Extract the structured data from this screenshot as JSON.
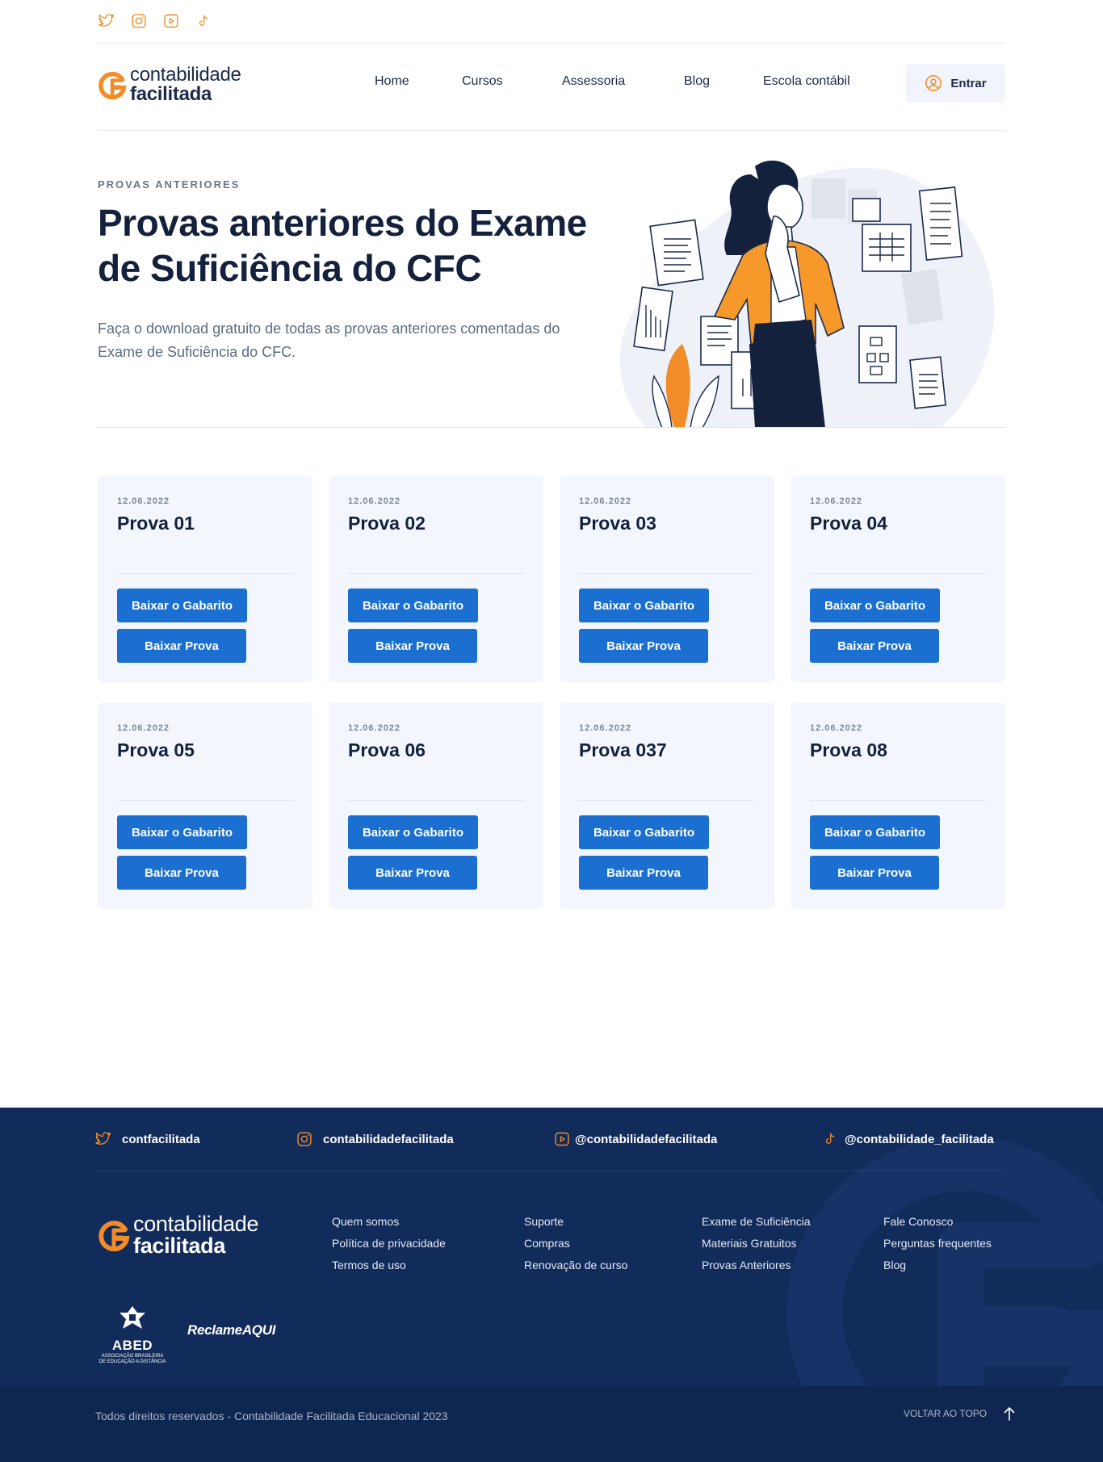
{
  "top_social": {
    "icons": [
      "twitter-icon",
      "instagram-icon",
      "youtube-icon",
      "tiktok-icon"
    ]
  },
  "brand": {
    "line1": "contabilidade",
    "line2": "facilitada",
    "accent_color": "#f28c28",
    "navy_color": "#1b2a4a"
  },
  "nav": {
    "items": [
      "Home",
      "Cursos",
      "Assessoria",
      "Blog",
      "Escola contábil"
    ],
    "login_label": "Entrar"
  },
  "hero": {
    "eyebrow": "PROVAS ANTERIORES",
    "title_plain": "Provas anteriores do ",
    "title_bold_1": "Exame",
    "title_bold_2": "de Suficiência do CFC",
    "subtitle": "Faça o download gratuito de todas as provas anteriores comentadas do Exame de Suficiência do CFC."
  },
  "cards": [
    {
      "date": "12.06.2022",
      "title": "Prova 01",
      "btn_gabarito": "Baixar o Gabarito",
      "btn_prova": "Baixar Prova"
    },
    {
      "date": "12.06.2022",
      "title": "Prova 02",
      "btn_gabarito": "Baixar o Gabarito",
      "btn_prova": "Baixar Prova"
    },
    {
      "date": "12.06.2022",
      "title": "Prova 03",
      "btn_gabarito": "Baixar o Gabarito",
      "btn_prova": "Baixar Prova"
    },
    {
      "date": "12.06.2022",
      "title": "Prova 04",
      "btn_gabarito": "Baixar o Gabarito",
      "btn_prova": "Baixar Prova"
    },
    {
      "date": "12.06.2022",
      "title": "Prova 05",
      "btn_gabarito": "Baixar o Gabarito",
      "btn_prova": "Baixar Prova"
    },
    {
      "date": "12.06.2022",
      "title": "Prova 06",
      "btn_gabarito": "Baixar o Gabarito",
      "btn_prova": "Baixar Prova"
    },
    {
      "date": "12.06.2022",
      "title": "Prova 037",
      "btn_gabarito": "Baixar o Gabarito",
      "btn_prova": "Baixar Prova"
    },
    {
      "date": "12.06.2022",
      "title": "Prova 08",
      "btn_gabarito": "Baixar o Gabarito",
      "btn_prova": "Baixar Prova"
    }
  ],
  "footer": {
    "social": [
      {
        "icon": "twitter-icon",
        "handle": "contfacilitada"
      },
      {
        "icon": "instagram-icon",
        "handle": "contabilidadefacilitada"
      },
      {
        "icon": "youtube-icon",
        "handle": "@contabilidadefacilitada"
      },
      {
        "icon": "tiktok-icon",
        "handle": "@contabilidade_facilitada"
      }
    ],
    "columns": [
      [
        "Quem somos",
        "Política de privacidade",
        "Termos de uso"
      ],
      [
        "Suporte",
        "Compras",
        "Renovação de curso"
      ],
      [
        "Exame de Suficiência",
        "Materiais Gratuitos",
        "Provas Anteriores"
      ],
      [
        "Fale Conosco",
        "Perguntas frequentes",
        "Blog"
      ]
    ],
    "abed_title": "ABED",
    "abed_sub": "ASSOCIAÇÃO BRASILEIRA DE EDUCAÇÃO A DISTÂNCIA",
    "reclame": "ReclameAQUI",
    "copyright": "Todos direitos reservados - Contabilidade Facilitada Educacional 2023",
    "back_to_top": "VOLTAR AO TOPO",
    "bg_color": "#112b5b"
  }
}
